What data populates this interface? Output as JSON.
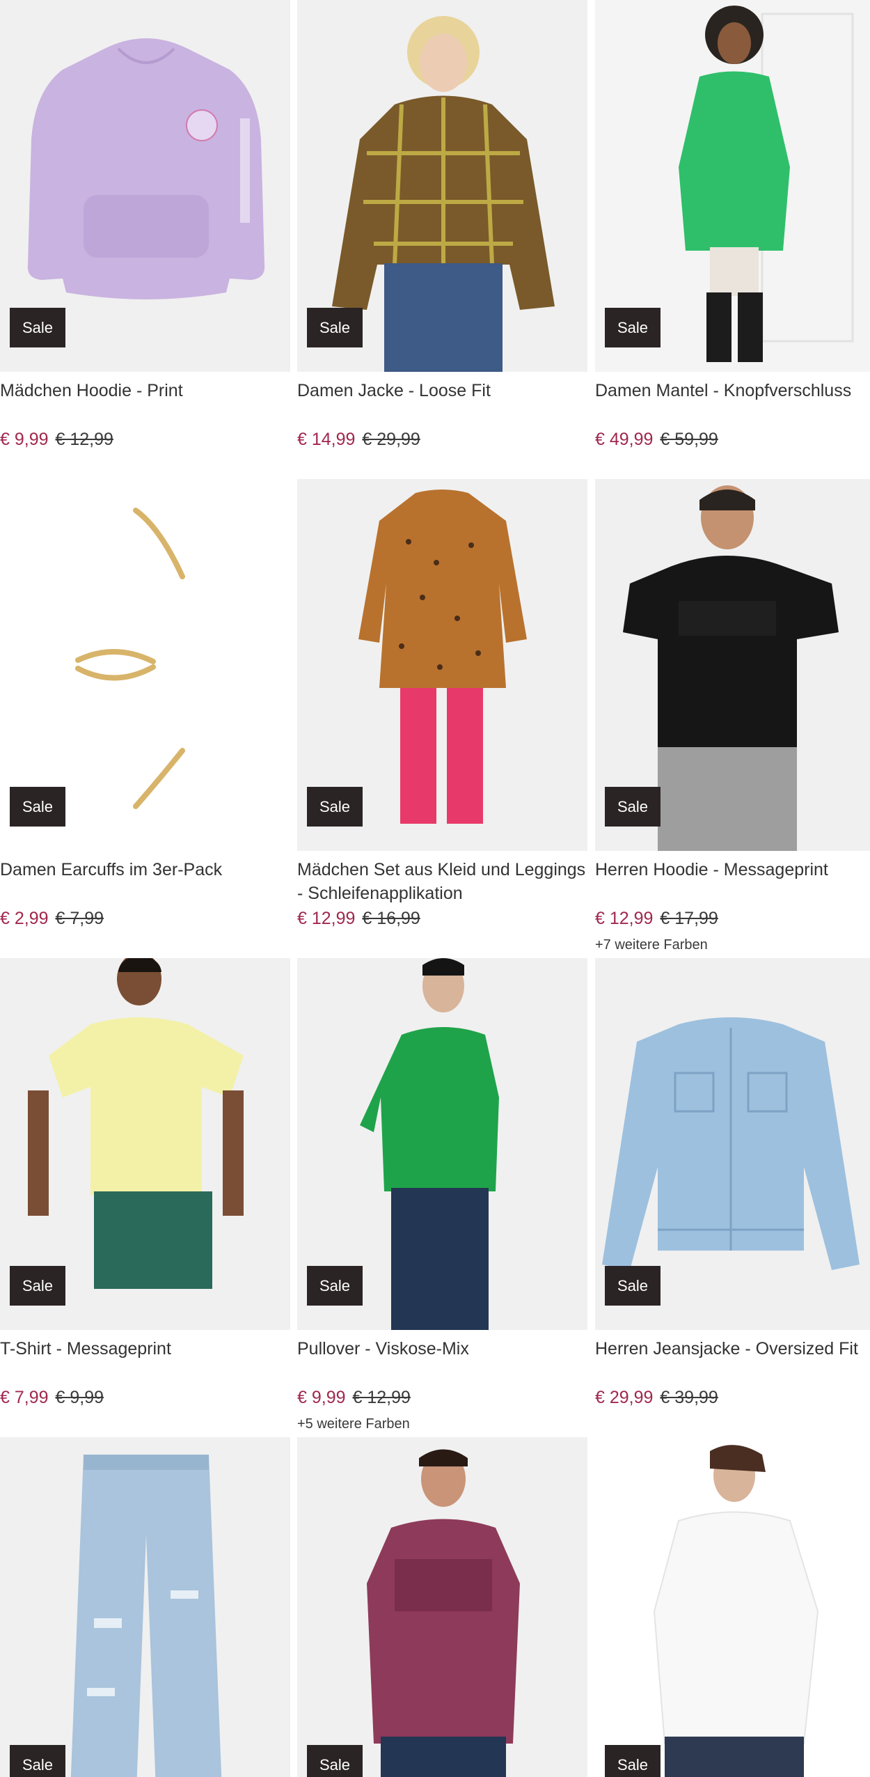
{
  "badge_label": "Sale",
  "accent_colors": {
    "price": "#a0284e",
    "badge_bg": "#2b2424"
  },
  "products": [
    {
      "title": "Mädchen Hoodie - Print",
      "price": "€ 9,99",
      "old_price": "€ 12,99",
      "colors_note": "",
      "image": "lilac-hoodie"
    },
    {
      "title": "Damen Jacke - Loose Fit",
      "price": "€ 14,99",
      "old_price": "€ 29,99",
      "colors_note": "",
      "image": "plaid-jacket"
    },
    {
      "title": "Damen Mantel - Knopfverschluss",
      "price": "€ 49,99",
      "old_price": "€ 59,99",
      "colors_note": "",
      "image": "green-coat"
    },
    {
      "title": "Damen Earcuffs im 3er-Pack",
      "price": "€ 2,99",
      "old_price": "€ 7,99",
      "colors_note": "",
      "image": "gold-earcuffs"
    },
    {
      "title": "Mädchen Set aus Kleid und Leggings - Schleifenapplikation",
      "price": "€ 12,99",
      "old_price": "€ 16,99",
      "colors_note": "",
      "image": "dress-leggings-set"
    },
    {
      "title": "Herren Hoodie - Messageprint",
      "price": "€ 12,99",
      "old_price": "€ 17,99",
      "colors_note": "+7 weitere Farben",
      "image": "black-hoodie"
    },
    {
      "title": "T-Shirt - Messageprint",
      "price": "€ 7,99",
      "old_price": "€ 9,99",
      "colors_note": "",
      "image": "yellow-tshirt"
    },
    {
      "title": "Pullover - Viskose-Mix",
      "price": "€ 9,99",
      "old_price": "€ 12,99",
      "colors_note": "+5 weitere Farben",
      "image": "green-pullover"
    },
    {
      "title": "Herren Jeansjacke - Oversized Fit",
      "price": "€ 29,99",
      "old_price": "€ 39,99",
      "colors_note": "",
      "image": "denim-jacket"
    },
    {
      "title": "",
      "price": "",
      "old_price": "",
      "colors_note": "",
      "image": "light-jeans"
    },
    {
      "title": "",
      "price": "",
      "old_price": "",
      "colors_note": "",
      "image": "burgundy-hoodie"
    },
    {
      "title": "",
      "price": "",
      "old_price": "",
      "colors_note": "",
      "image": "white-hoodie"
    }
  ]
}
